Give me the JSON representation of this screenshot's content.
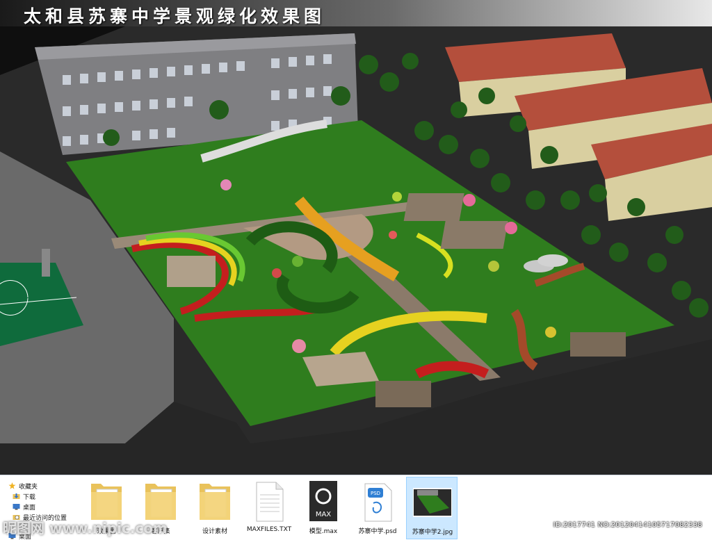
{
  "image": {
    "title": "太和县苏寨中学景观绿化效果图"
  },
  "nav": {
    "items": [
      {
        "label": "收藏夹",
        "icon": "star-icon"
      },
      {
        "label": "下载",
        "icon": "download-folder-icon"
      },
      {
        "label": "桌面",
        "icon": "desktop-icon"
      },
      {
        "label": "最近访问的位置",
        "icon": "recent-places-icon"
      },
      {
        "label": "桌面",
        "icon": "desktop-icon"
      }
    ]
  },
  "files": [
    {
      "label": "效果图",
      "type": "folder"
    },
    {
      "label": "客户集",
      "type": "folder"
    },
    {
      "label": "设计素材",
      "type": "folder"
    },
    {
      "label": "MAXFILES.TXT",
      "type": "text"
    },
    {
      "label": "模型.max",
      "type": "max",
      "icon_text": "MAX"
    },
    {
      "label": "苏寨中学.psd",
      "type": "psd",
      "icon_text": "PSD"
    },
    {
      "label": "苏寨中学2.jpg",
      "type": "jpg"
    }
  ],
  "watermark": {
    "id_text": "ID:2017741 NO:20120414105717082338",
    "site": "昵图网 www.nipic.com"
  }
}
